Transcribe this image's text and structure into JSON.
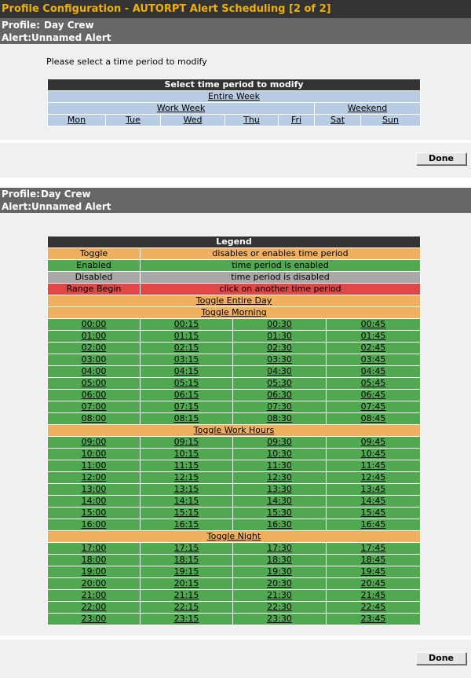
{
  "header": {
    "title": "Profile Configuration - AUTORPT Alert Scheduling [2 of 2]",
    "profile_label": "Profile:",
    "profile_value": "Day Crew",
    "alert_label": "Alert:",
    "alert_value": "Unnamed Alert"
  },
  "selector": {
    "prompt": "Please select a time period to modify",
    "title": "Select time period to modify",
    "entire_week": "Entire Week",
    "work_week": "Work Week",
    "weekend": "Weekend",
    "days": [
      "Mon",
      "Tue",
      "Wed",
      "Thu",
      "Fri",
      "Sat",
      "Sun"
    ]
  },
  "done_label": "Done",
  "legend": {
    "title": "Legend",
    "items": [
      {
        "key": "Toggle",
        "desc": "disables or enables time period"
      },
      {
        "key": "Enabled",
        "desc": "time period is enabled"
      },
      {
        "key": "Disabled",
        "desc": "time period is disabled"
      },
      {
        "key": "Range Begin",
        "desc": "click on another time period"
      }
    ]
  },
  "toggles": {
    "entire_day": "Toggle Entire Day",
    "morning": "Toggle Morning",
    "work_hours": "Toggle Work Hours",
    "night": "Toggle Night"
  },
  "slots": {
    "morning": [
      [
        "00:00",
        "00:15",
        "00:30",
        "00:45"
      ],
      [
        "01:00",
        "01:15",
        "01:30",
        "01:45"
      ],
      [
        "02:00",
        "02:15",
        "02:30",
        "02:45"
      ],
      [
        "03:00",
        "03:15",
        "03:30",
        "03:45"
      ],
      [
        "04:00",
        "04:15",
        "04:30",
        "04:45"
      ],
      [
        "05:00",
        "05:15",
        "05:30",
        "05:45"
      ],
      [
        "06:00",
        "06:15",
        "06:30",
        "06:45"
      ],
      [
        "07:00",
        "07:15",
        "07:30",
        "07:45"
      ],
      [
        "08:00",
        "08:15",
        "08:30",
        "08:45"
      ]
    ],
    "work_hours": [
      [
        "09:00",
        "09:15",
        "09:30",
        "09:45"
      ],
      [
        "10:00",
        "10:15",
        "10:30",
        "10:45"
      ],
      [
        "11:00",
        "11:15",
        "11:30",
        "11:45"
      ],
      [
        "12:00",
        "12:15",
        "12:30",
        "12:45"
      ],
      [
        "13:00",
        "13:15",
        "13:30",
        "13:45"
      ],
      [
        "14:00",
        "14:15",
        "14:30",
        "14:45"
      ],
      [
        "15:00",
        "15:15",
        "15:30",
        "15:45"
      ],
      [
        "16:00",
        "16:15",
        "16:30",
        "16:45"
      ]
    ],
    "night": [
      [
        "17:00",
        "17:15",
        "17:30",
        "17:45"
      ],
      [
        "18:00",
        "18:15",
        "18:30",
        "18:45"
      ],
      [
        "19:00",
        "19:15",
        "19:30",
        "19:45"
      ],
      [
        "20:00",
        "20:15",
        "20:30",
        "20:45"
      ],
      [
        "21:00",
        "21:15",
        "21:30",
        "21:45"
      ],
      [
        "22:00",
        "22:15",
        "22:30",
        "22:45"
      ],
      [
        "23:00",
        "23:15",
        "23:30",
        "23:45"
      ]
    ]
  },
  "colors": {
    "enabled": "#50a850",
    "disabled": "#a8a8a8",
    "toggle": "#f0b060",
    "range_begin": "#e04848",
    "title_text": "#f0b000"
  }
}
